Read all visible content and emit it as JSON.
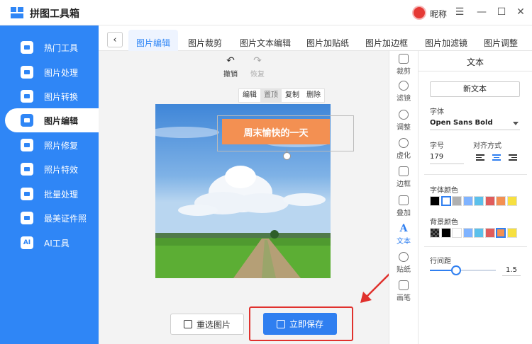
{
  "app": {
    "title": "拼图工具箱",
    "nickname": "昵称"
  },
  "window": {
    "menu_icon": "☰",
    "minimize_icon": "—",
    "maximize_icon": "☐",
    "close_icon": "✕"
  },
  "sidebar": {
    "items": [
      {
        "label": "热门工具",
        "icon": "hot-tools-icon"
      },
      {
        "label": "图片处理",
        "icon": "image-process-icon"
      },
      {
        "label": "图片转换",
        "icon": "image-convert-icon"
      },
      {
        "label": "图片编辑",
        "icon": "image-edit-icon",
        "active": true
      },
      {
        "label": "照片修复",
        "icon": "photo-repair-icon"
      },
      {
        "label": "照片特效",
        "icon": "photo-effect-icon"
      },
      {
        "label": "批量处理",
        "icon": "batch-icon"
      },
      {
        "label": "最美证件照",
        "icon": "id-photo-icon"
      },
      {
        "label": "AI工具",
        "icon": "ai-icon",
        "icon_text": "AI"
      }
    ]
  },
  "tabs": [
    {
      "label": "图片编辑",
      "active": true
    },
    {
      "label": "图片裁剪"
    },
    {
      "label": "图片文本编辑"
    },
    {
      "label": "图片加贴纸"
    },
    {
      "label": "图片加边框"
    },
    {
      "label": "图片加滤镜"
    },
    {
      "label": "图片调整"
    }
  ],
  "editor": {
    "undo_label": "撤销",
    "redo_label": "恢复",
    "mini_toolbar": [
      "编辑",
      "置顶",
      "复制",
      "删除"
    ],
    "text_overlay": "周末愉快的一天",
    "reselect_label": "重选图片",
    "save_label": "立即保存"
  },
  "tools": [
    {
      "label": "裁剪",
      "icon": "crop-icon"
    },
    {
      "label": "滤镜",
      "icon": "filter-icon"
    },
    {
      "label": "调整",
      "icon": "adjust-icon"
    },
    {
      "label": "虚化",
      "icon": "blur-icon"
    },
    {
      "label": "边框",
      "icon": "border-icon"
    },
    {
      "label": "叠加",
      "icon": "overlay-icon"
    },
    {
      "label": "文本",
      "icon": "text-icon",
      "active": true
    },
    {
      "label": "贴纸",
      "icon": "sticker-icon"
    },
    {
      "label": "画笔",
      "icon": "brush-icon"
    }
  ],
  "panel": {
    "title": "文本",
    "new_text": "新文本",
    "font_label": "字体",
    "font_value": "Open Sans Bold",
    "size_label": "字号",
    "size_value": "179",
    "align_label": "对齐方式",
    "align_selected": "center",
    "font_color_label": "字体颜色",
    "font_colors": [
      "#000000",
      "#ffffff",
      "#b0b0b0",
      "#7fb3ff",
      "#5bc0eb",
      "#e05c5c",
      "#f39052",
      "#f7e040"
    ],
    "font_color_selected": 1,
    "bg_color_label": "背景颜色",
    "bg_colors": [
      "checker",
      "#000000",
      "#ffffff",
      "#7fb3ff",
      "#5bc0eb",
      "#e05c5c",
      "#f39052",
      "#f7e040"
    ],
    "bg_color_selected": 6,
    "line_spacing_label": "行间距",
    "line_spacing_value": "1.5",
    "line_spacing_fraction": 0.4
  }
}
